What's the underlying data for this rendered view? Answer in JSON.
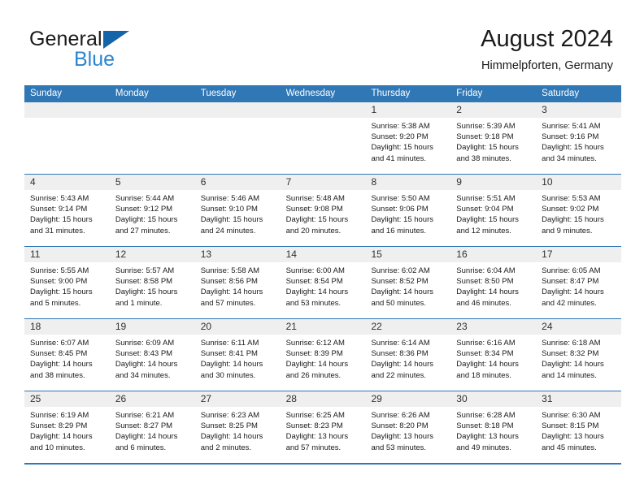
{
  "brand": {
    "line1": "General",
    "line2": "Blue",
    "triangle_color": "#1464aa",
    "blue_text_color": "#2a85d0"
  },
  "header": {
    "title": "August 2024",
    "subtitle": "Himmelpforten, Germany"
  },
  "colors": {
    "header_row_bg": "#3077b5",
    "header_row_text": "#ffffff",
    "daynum_bg": "#efefef",
    "rule": "#3077b5",
    "body_text": "#1a1a1a"
  },
  "weekdays": [
    "Sunday",
    "Monday",
    "Tuesday",
    "Wednesday",
    "Thursday",
    "Friday",
    "Saturday"
  ],
  "labels": {
    "sunrise_prefix": "Sunrise:",
    "sunset_prefix": "Sunset:",
    "daylight_prefix": "Daylight:"
  },
  "weeks": [
    [
      {
        "day": "",
        "sunrise": "",
        "sunset": "",
        "daylight_line1": "",
        "daylight_line2": ""
      },
      {
        "day": "",
        "sunrise": "",
        "sunset": "",
        "daylight_line1": "",
        "daylight_line2": ""
      },
      {
        "day": "",
        "sunrise": "",
        "sunset": "",
        "daylight_line1": "",
        "daylight_line2": ""
      },
      {
        "day": "",
        "sunrise": "",
        "sunset": "",
        "daylight_line1": "",
        "daylight_line2": ""
      },
      {
        "day": "1",
        "sunrise": "Sunrise: 5:38 AM",
        "sunset": "Sunset: 9:20 PM",
        "daylight_line1": "Daylight: 15 hours",
        "daylight_line2": "and 41 minutes."
      },
      {
        "day": "2",
        "sunrise": "Sunrise: 5:39 AM",
        "sunset": "Sunset: 9:18 PM",
        "daylight_line1": "Daylight: 15 hours",
        "daylight_line2": "and 38 minutes."
      },
      {
        "day": "3",
        "sunrise": "Sunrise: 5:41 AM",
        "sunset": "Sunset: 9:16 PM",
        "daylight_line1": "Daylight: 15 hours",
        "daylight_line2": "and 34 minutes."
      }
    ],
    [
      {
        "day": "4",
        "sunrise": "Sunrise: 5:43 AM",
        "sunset": "Sunset: 9:14 PM",
        "daylight_line1": "Daylight: 15 hours",
        "daylight_line2": "and 31 minutes."
      },
      {
        "day": "5",
        "sunrise": "Sunrise: 5:44 AM",
        "sunset": "Sunset: 9:12 PM",
        "daylight_line1": "Daylight: 15 hours",
        "daylight_line2": "and 27 minutes."
      },
      {
        "day": "6",
        "sunrise": "Sunrise: 5:46 AM",
        "sunset": "Sunset: 9:10 PM",
        "daylight_line1": "Daylight: 15 hours",
        "daylight_line2": "and 24 minutes."
      },
      {
        "day": "7",
        "sunrise": "Sunrise: 5:48 AM",
        "sunset": "Sunset: 9:08 PM",
        "daylight_line1": "Daylight: 15 hours",
        "daylight_line2": "and 20 minutes."
      },
      {
        "day": "8",
        "sunrise": "Sunrise: 5:50 AM",
        "sunset": "Sunset: 9:06 PM",
        "daylight_line1": "Daylight: 15 hours",
        "daylight_line2": "and 16 minutes."
      },
      {
        "day": "9",
        "sunrise": "Sunrise: 5:51 AM",
        "sunset": "Sunset: 9:04 PM",
        "daylight_line1": "Daylight: 15 hours",
        "daylight_line2": "and 12 minutes."
      },
      {
        "day": "10",
        "sunrise": "Sunrise: 5:53 AM",
        "sunset": "Sunset: 9:02 PM",
        "daylight_line1": "Daylight: 15 hours",
        "daylight_line2": "and 9 minutes."
      }
    ],
    [
      {
        "day": "11",
        "sunrise": "Sunrise: 5:55 AM",
        "sunset": "Sunset: 9:00 PM",
        "daylight_line1": "Daylight: 15 hours",
        "daylight_line2": "and 5 minutes."
      },
      {
        "day": "12",
        "sunrise": "Sunrise: 5:57 AM",
        "sunset": "Sunset: 8:58 PM",
        "daylight_line1": "Daylight: 15 hours",
        "daylight_line2": "and 1 minute."
      },
      {
        "day": "13",
        "sunrise": "Sunrise: 5:58 AM",
        "sunset": "Sunset: 8:56 PM",
        "daylight_line1": "Daylight: 14 hours",
        "daylight_line2": "and 57 minutes."
      },
      {
        "day": "14",
        "sunrise": "Sunrise: 6:00 AM",
        "sunset": "Sunset: 8:54 PM",
        "daylight_line1": "Daylight: 14 hours",
        "daylight_line2": "and 53 minutes."
      },
      {
        "day": "15",
        "sunrise": "Sunrise: 6:02 AM",
        "sunset": "Sunset: 8:52 PM",
        "daylight_line1": "Daylight: 14 hours",
        "daylight_line2": "and 50 minutes."
      },
      {
        "day": "16",
        "sunrise": "Sunrise: 6:04 AM",
        "sunset": "Sunset: 8:50 PM",
        "daylight_line1": "Daylight: 14 hours",
        "daylight_line2": "and 46 minutes."
      },
      {
        "day": "17",
        "sunrise": "Sunrise: 6:05 AM",
        "sunset": "Sunset: 8:47 PM",
        "daylight_line1": "Daylight: 14 hours",
        "daylight_line2": "and 42 minutes."
      }
    ],
    [
      {
        "day": "18",
        "sunrise": "Sunrise: 6:07 AM",
        "sunset": "Sunset: 8:45 PM",
        "daylight_line1": "Daylight: 14 hours",
        "daylight_line2": "and 38 minutes."
      },
      {
        "day": "19",
        "sunrise": "Sunrise: 6:09 AM",
        "sunset": "Sunset: 8:43 PM",
        "daylight_line1": "Daylight: 14 hours",
        "daylight_line2": "and 34 minutes."
      },
      {
        "day": "20",
        "sunrise": "Sunrise: 6:11 AM",
        "sunset": "Sunset: 8:41 PM",
        "daylight_line1": "Daylight: 14 hours",
        "daylight_line2": "and 30 minutes."
      },
      {
        "day": "21",
        "sunrise": "Sunrise: 6:12 AM",
        "sunset": "Sunset: 8:39 PM",
        "daylight_line1": "Daylight: 14 hours",
        "daylight_line2": "and 26 minutes."
      },
      {
        "day": "22",
        "sunrise": "Sunrise: 6:14 AM",
        "sunset": "Sunset: 8:36 PM",
        "daylight_line1": "Daylight: 14 hours",
        "daylight_line2": "and 22 minutes."
      },
      {
        "day": "23",
        "sunrise": "Sunrise: 6:16 AM",
        "sunset": "Sunset: 8:34 PM",
        "daylight_line1": "Daylight: 14 hours",
        "daylight_line2": "and 18 minutes."
      },
      {
        "day": "24",
        "sunrise": "Sunrise: 6:18 AM",
        "sunset": "Sunset: 8:32 PM",
        "daylight_line1": "Daylight: 14 hours",
        "daylight_line2": "and 14 minutes."
      }
    ],
    [
      {
        "day": "25",
        "sunrise": "Sunrise: 6:19 AM",
        "sunset": "Sunset: 8:29 PM",
        "daylight_line1": "Daylight: 14 hours",
        "daylight_line2": "and 10 minutes."
      },
      {
        "day": "26",
        "sunrise": "Sunrise: 6:21 AM",
        "sunset": "Sunset: 8:27 PM",
        "daylight_line1": "Daylight: 14 hours",
        "daylight_line2": "and 6 minutes."
      },
      {
        "day": "27",
        "sunrise": "Sunrise: 6:23 AM",
        "sunset": "Sunset: 8:25 PM",
        "daylight_line1": "Daylight: 14 hours",
        "daylight_line2": "and 2 minutes."
      },
      {
        "day": "28",
        "sunrise": "Sunrise: 6:25 AM",
        "sunset": "Sunset: 8:23 PM",
        "daylight_line1": "Daylight: 13 hours",
        "daylight_line2": "and 57 minutes."
      },
      {
        "day": "29",
        "sunrise": "Sunrise: 6:26 AM",
        "sunset": "Sunset: 8:20 PM",
        "daylight_line1": "Daylight: 13 hours",
        "daylight_line2": "and 53 minutes."
      },
      {
        "day": "30",
        "sunrise": "Sunrise: 6:28 AM",
        "sunset": "Sunset: 8:18 PM",
        "daylight_line1": "Daylight: 13 hours",
        "daylight_line2": "and 49 minutes."
      },
      {
        "day": "31",
        "sunrise": "Sunrise: 6:30 AM",
        "sunset": "Sunset: 8:15 PM",
        "daylight_line1": "Daylight: 13 hours",
        "daylight_line2": "and 45 minutes."
      }
    ]
  ]
}
